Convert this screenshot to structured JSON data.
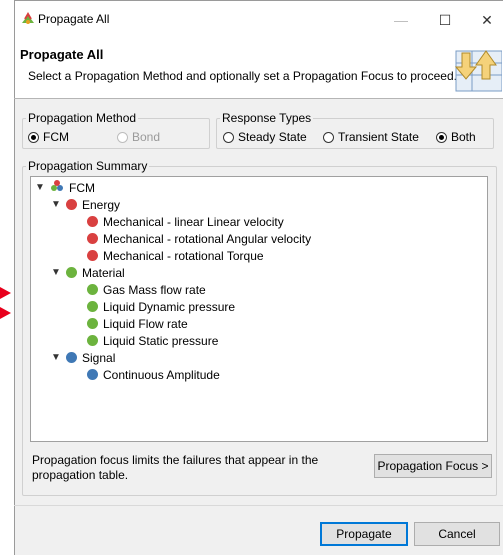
{
  "window": {
    "title": "Propagate All"
  },
  "header": {
    "title": "Propagate All",
    "description": "Select a Propagation Method and optionally set a Propagation Focus to proceed."
  },
  "propagation_method": {
    "legend": "Propagation Method",
    "options": [
      {
        "label": "FCM",
        "selected": true,
        "enabled": true
      },
      {
        "label": "Bond",
        "selected": false,
        "enabled": false
      }
    ]
  },
  "response_types": {
    "legend": "Response Types",
    "options": [
      {
        "label": "Steady State",
        "selected": false
      },
      {
        "label": "Transient State",
        "selected": false
      },
      {
        "label": "Both",
        "selected": true
      }
    ]
  },
  "summary": {
    "legend": "Propagation Summary",
    "root": "FCM",
    "groups": [
      {
        "label": "Energy",
        "color": "#d94040",
        "items": [
          "Mechanical - linear Linear velocity",
          "Mechanical - rotational Angular velocity",
          "Mechanical - rotational Torque"
        ]
      },
      {
        "label": "Material",
        "color": "#6cb33e",
        "items": [
          "Gas Mass flow rate",
          "Liquid Dynamic pressure",
          "Liquid Flow rate",
          "Liquid Static pressure"
        ]
      },
      {
        "label": "Signal",
        "color": "#3f78b5",
        "items": [
          "Continuous Amplitude"
        ]
      }
    ]
  },
  "focus": {
    "note_line1": "Propagation focus limits the failures that appear in the",
    "note_line2": "propagation table.",
    "button": "Propagation Focus >"
  },
  "actions": {
    "propagate": "Propagate",
    "cancel": "Cancel"
  },
  "colors": {
    "accent": "#0078d7",
    "marker": "#e8001c"
  }
}
